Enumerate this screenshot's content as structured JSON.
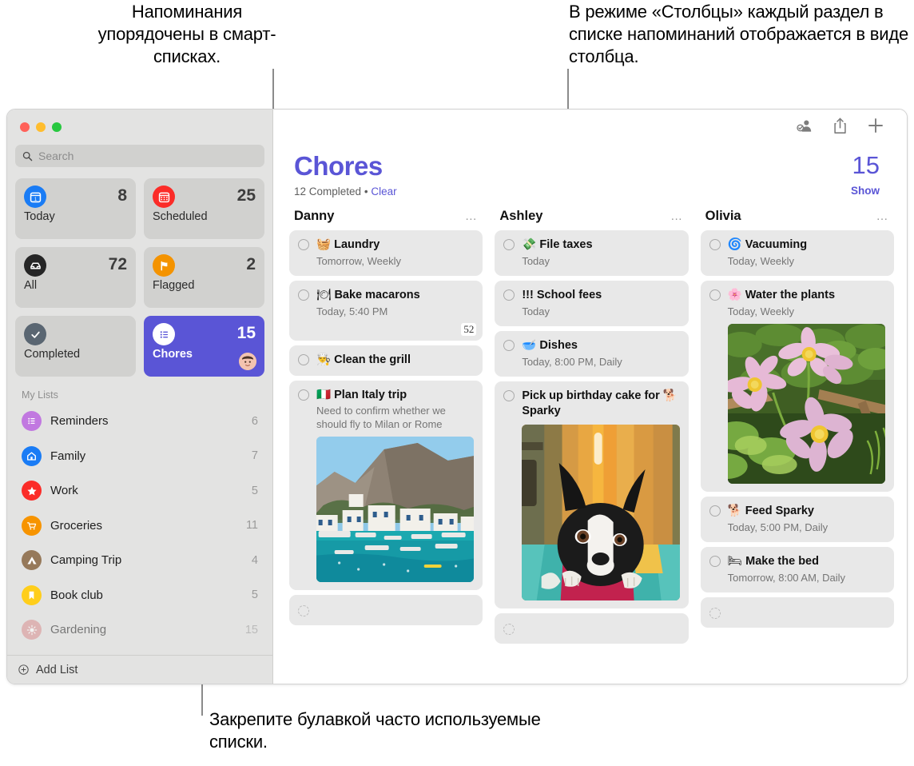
{
  "annotations": {
    "top_left": "Напоминания упорядочены в смарт-списках.",
    "top_right": "В режиме «Столбцы» каждый раздел в списке напоминаний отображается в виде столбца.",
    "bottom_left": "Закрепите булавкой часто используемые списки."
  },
  "window": {
    "traffic_lights": [
      "close-button",
      "minimize-button",
      "maximize-button"
    ]
  },
  "search": {
    "placeholder": "Search",
    "icon": "search-icon"
  },
  "smart_lists": [
    {
      "label": "Today",
      "count": "8",
      "icon": "calendar-day-icon",
      "color": "#1a7cf5",
      "selected": false
    },
    {
      "label": "Scheduled",
      "count": "25",
      "icon": "calendar-icon",
      "color": "#fb2c28",
      "selected": false
    },
    {
      "label": "All",
      "count": "72",
      "icon": "inbox-tray-icon",
      "color": "#262626",
      "selected": false
    },
    {
      "label": "Flagged",
      "count": "2",
      "icon": "flag-icon",
      "color": "#f49300",
      "selected": false
    },
    {
      "label": "Completed",
      "count": "",
      "icon": "checkmark-icon",
      "color": "#5a6672",
      "selected": false
    },
    {
      "label": "Chores",
      "count": "15",
      "icon": "list-bullet-icon",
      "color": "#ffffff",
      "selected": true,
      "avatar": "avatar-face"
    }
  ],
  "my_lists": {
    "header": "My Lists",
    "items": [
      {
        "label": "Reminders",
        "count": "6",
        "icon": "list-bullet-icon",
        "color": "#c178e0"
      },
      {
        "label": "Family",
        "count": "7",
        "icon": "house-icon",
        "color": "#1a7cf5"
      },
      {
        "label": "Work",
        "count": "5",
        "icon": "star-icon",
        "color": "#fb2c28"
      },
      {
        "label": "Groceries",
        "count": "11",
        "icon": "cart-icon",
        "color": "#f79400"
      },
      {
        "label": "Camping Trip",
        "count": "4",
        "icon": "tent-icon",
        "color": "#96795a"
      },
      {
        "label": "Book club",
        "count": "5",
        "icon": "bookmark-icon",
        "color": "#ffce1b"
      },
      {
        "label": "Gardening",
        "count": "15",
        "icon": "sun-icon",
        "color": "#d98f8f"
      }
    ]
  },
  "add_list": {
    "label": "Add List",
    "icon": "plus-circle-icon"
  },
  "toolbar": {
    "share_people_icon": "person-badge-checkmark-icon",
    "share_icon": "share-up-arrow-icon",
    "add_icon": "plus-icon"
  },
  "header": {
    "title": "Chores",
    "completed_text": "12 Completed",
    "separator": "•",
    "clear_label": "Clear",
    "count": "15",
    "show_label": "Show",
    "accent": "#5a55d6"
  },
  "columns": [
    {
      "name": "Danny",
      "menu": "…",
      "cards": [
        {
          "emoji": "🧺",
          "title": "Laundry",
          "meta": "Tomorrow, Weekly"
        },
        {
          "emoji": "🍽",
          "title": "Bake macarons",
          "meta": "Today, 5:40 PM",
          "page_badge": "52"
        },
        {
          "emoji": "👨‍🍳",
          "title": "Clean the grill"
        },
        {
          "emoji": "🇮🇹",
          "title": "Plan Italy trip",
          "note": "Need to confirm whether we should fly to Milan or Rome",
          "photo": "italy"
        },
        {
          "empty": true
        }
      ]
    },
    {
      "name": "Ashley",
      "menu": "…",
      "cards": [
        {
          "emoji": "💸",
          "title": "File taxes",
          "meta": "Today"
        },
        {
          "emoji": "",
          "title": "!!! School fees",
          "meta": "Today"
        },
        {
          "emoji": "🥣",
          "title": "Dishes",
          "meta": "Today, 8:00 PM, Daily"
        },
        {
          "emoji": "",
          "title": "Pick up birthday cake for 🐕 Sparky",
          "photo": "dog"
        },
        {
          "empty": true
        }
      ]
    },
    {
      "name": "Olivia",
      "menu": "…",
      "cards": [
        {
          "emoji": "🌀",
          "title": "Vacuuming",
          "meta": "Today, Weekly"
        },
        {
          "emoji": "🌸",
          "title": "Water the plants",
          "meta": "Today, Weekly",
          "photo": "flowers"
        },
        {
          "emoji": "🐕",
          "title": "Feed Sparky",
          "meta": "Today, 5:00 PM, Daily"
        },
        {
          "emoji": "🛏",
          "title": "Make the bed",
          "meta": "Tomorrow, 8:00 AM, Daily"
        },
        {
          "empty": true
        }
      ]
    }
  ]
}
